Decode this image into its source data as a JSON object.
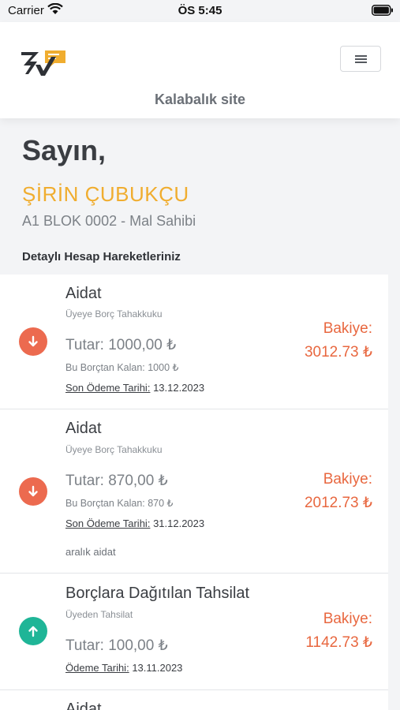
{
  "status_bar": {
    "carrier": "Carrier",
    "time": "ÖS 5:45"
  },
  "header": {
    "site_title": "Kalabalık site",
    "menu_icon": "hamburger-icon",
    "logo": "brand-logo"
  },
  "greeting": {
    "salutation": "Sayın,",
    "name": "ŞİRİN ÇUBUKÇU",
    "unit": "A1 BLOK 0002 - Mal Sahibi"
  },
  "section_title": "Detaylı Hesap Hareketleriniz",
  "colors": {
    "accent_orange": "#f0ad2f",
    "debit_red": "#ec6a4f",
    "credit_green": "#1fb597",
    "balance_text": "#e8673f"
  },
  "transactions": [
    {
      "direction": "down",
      "title": "Aidat",
      "type": "Üyeye Borç Tahakkuku",
      "amount": "Tutar: 1000,00 ₺",
      "remaining": "Bu Borçtan Kalan: 1000 ₺",
      "due_label": "Son Ödeme Tarihi:",
      "due_date": "13.12.2023",
      "note": "",
      "balance_label": "Bakiye:",
      "balance": "3012.73 ₺"
    },
    {
      "direction": "down",
      "title": "Aidat",
      "type": "Üyeye Borç Tahakkuku",
      "amount": "Tutar: 870,00 ₺",
      "remaining": "Bu Borçtan Kalan: 870 ₺",
      "due_label": "Son Ödeme Tarihi:",
      "due_date": "31.12.2023",
      "note": "aralık aidat",
      "balance_label": "Bakiye:",
      "balance": "2012.73 ₺"
    },
    {
      "direction": "up",
      "title": "Borçlara Dağıtılan Tahsilat",
      "type": "Üyeden Tahsilat",
      "amount": "Tutar: 100,00 ₺",
      "remaining": "",
      "due_label": "Ödeme Tarihi:",
      "due_date": "13.11.2023",
      "note": "",
      "balance_label": "Bakiye:",
      "balance": "1142.73 ₺"
    },
    {
      "direction": "down",
      "title": "Aidat",
      "type": "",
      "amount": "",
      "remaining": "",
      "due_label": "",
      "due_date": "",
      "note": "",
      "balance_label": "",
      "balance": ""
    }
  ]
}
